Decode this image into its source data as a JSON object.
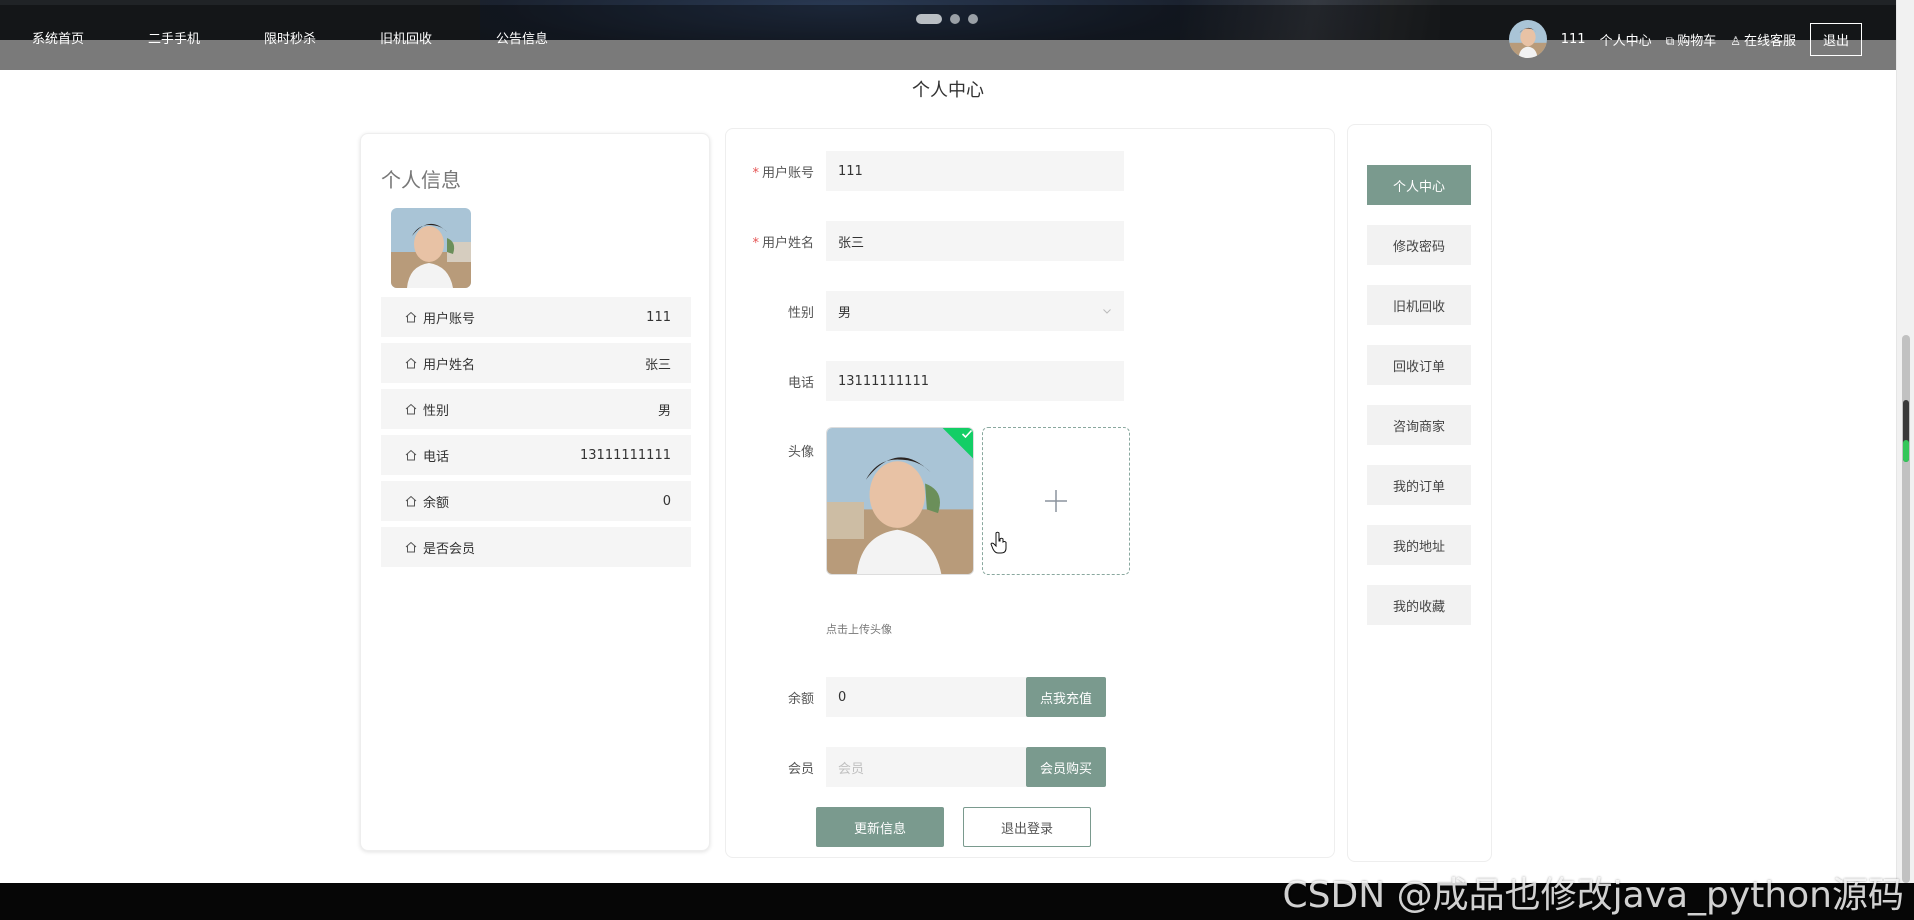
{
  "nav": {
    "items": [
      "系统首页",
      "二手手机",
      "限时秒杀",
      "旧机回收",
      "公告信息"
    ]
  },
  "user": {
    "name": "111",
    "center": "个人中心",
    "cart": "购物车",
    "service": "在线客服",
    "logout": "退出"
  },
  "page": {
    "title": "个人中心"
  },
  "profile_card": {
    "title": "个人信息",
    "rows": [
      {
        "label": "用户账号",
        "value": "111"
      },
      {
        "label": "用户姓名",
        "value": "张三"
      },
      {
        "label": "性别",
        "value": "男"
      },
      {
        "label": "电话",
        "value": "13111111111"
      },
      {
        "label": "余额",
        "value": "0"
      },
      {
        "label": "是否会员",
        "value": ""
      }
    ]
  },
  "form": {
    "account_label": "用户账号",
    "account_value": "111",
    "name_label": "用户姓名",
    "name_value": "张三",
    "gender_label": "性别",
    "gender_value": "男",
    "phone_label": "电话",
    "phone_value": "13111111111",
    "avatar_label": "头像",
    "avatar_hint": "点击上传头像",
    "balance_label": "余额",
    "balance_value": "0",
    "recharge_button": "点我充值",
    "member_label": "会员",
    "member_placeholder": "会员",
    "member_buy_button": "会员购买",
    "update_button": "更新信息",
    "logout_button": "退出登录"
  },
  "menu": {
    "items": [
      "个人中心",
      "修改密码",
      "旧机回收",
      "回收订单",
      "咨询商家",
      "我的订单",
      "我的地址",
      "我的收藏"
    ],
    "active_index": 0
  },
  "watermark": "CSDN @成品也修改java_python源码",
  "colors": {
    "accent": "#7a9a8e",
    "header": "#202326",
    "success": "#13ce66"
  }
}
